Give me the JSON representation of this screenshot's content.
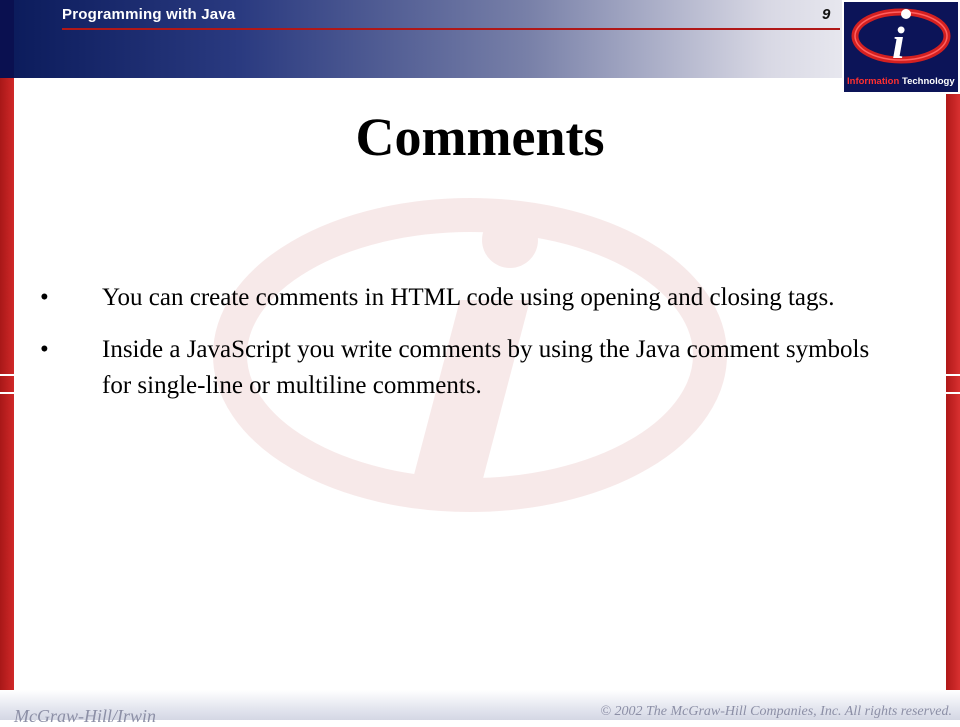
{
  "header": {
    "title": "Programming with Java",
    "slide_number": "9"
  },
  "logo": {
    "letter": "i",
    "caption_part1": "Information",
    "caption_part2": "Technology"
  },
  "slide": {
    "title": "Comments",
    "bullets": [
      {
        "marker": "•",
        "text": "You can create comments in HTML code using opening and closing tags."
      },
      {
        "marker": "•",
        "text": "Inside a JavaScript you write comments by using the Java comment symbols for single-line or multiline comments."
      }
    ]
  },
  "footer": {
    "publisher": "McGraw-Hill/Irwin",
    "copyright": "© 2002  The McGraw-Hill  Companies, Inc. All rights reserved."
  },
  "colors": {
    "navy": "#0a1a5a",
    "red": "#c02020"
  }
}
